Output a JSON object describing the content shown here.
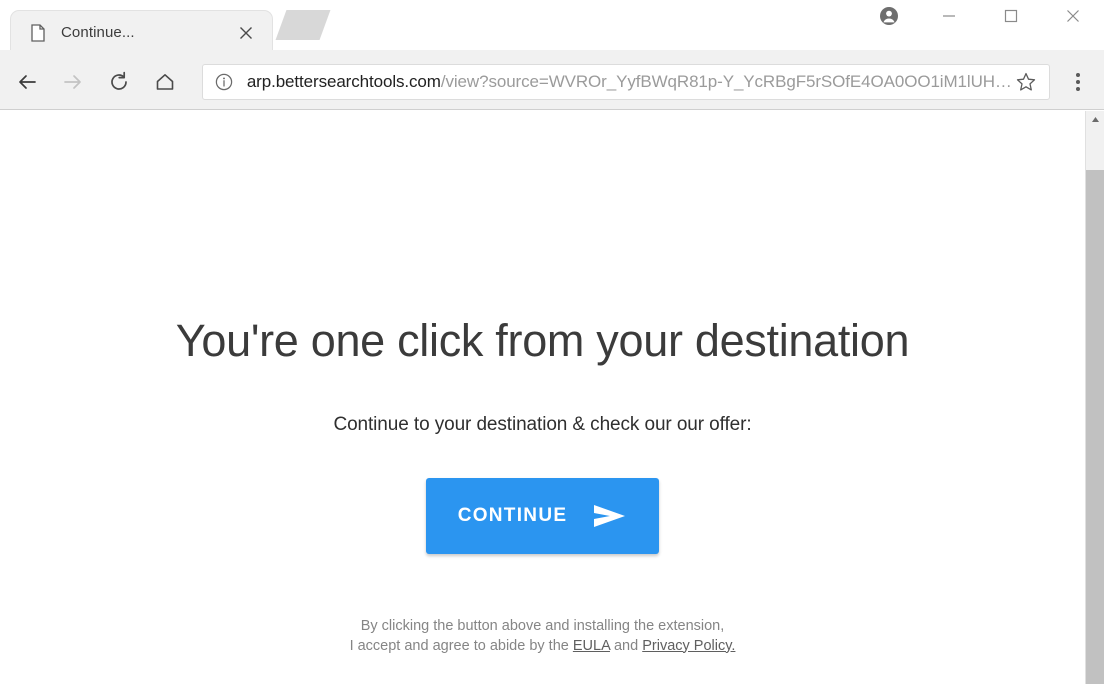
{
  "browser": {
    "tab": {
      "title": "Continue...",
      "favicon_icon": "document-icon",
      "close_icon": "close-icon"
    },
    "newtab_button_label": "",
    "window_controls": {
      "profile_icon": "account-circle-icon",
      "minimize_label": "–",
      "maximize_label": "□",
      "close_label": "×"
    },
    "toolbar": {
      "back_icon": "back-arrow-icon",
      "forward_icon": "forward-arrow-icon",
      "reload_icon": "reload-icon",
      "home_icon": "home-icon",
      "info_icon": "info-circle-icon",
      "bookmark_icon": "star-icon",
      "menu_icon": "three-dot-menu-icon"
    },
    "omnibox": {
      "host": "arp.bettersearchtools.com",
      "path": "/view?source=WVROr_YyfBWqR81p-Y_YcRBgF5rSOfE4OA0OO1iM1lUH…",
      "full_url": "arp.bettersearchtools.com/view?source=WVROr_YyfBWqR81p-Y_YcRBgF5rSOfE4OA0OO1iM1lUH…"
    }
  },
  "page": {
    "headline": "You're one click from your destination",
    "subtitle": "Continue to your destination & check our our offer:",
    "cta": {
      "label": "CONTINUE",
      "icon": "send-arrow-icon",
      "color": "#2b95f0",
      "text_color": "#ffffff"
    },
    "legal": {
      "line1": "By clicking the button above and installing the extension,",
      "line2_prefix": "I accept and agree to abide by the ",
      "eula_label": "EULA",
      "line2_mid": " and ",
      "privacy_label": "Privacy Policy.",
      "color": "#858585"
    }
  },
  "scrollbar": {
    "up_arrow_icon": "scroll-up-arrow-icon",
    "thumb_color": "#c1c1c1",
    "track_color": "#f1f1f1"
  }
}
